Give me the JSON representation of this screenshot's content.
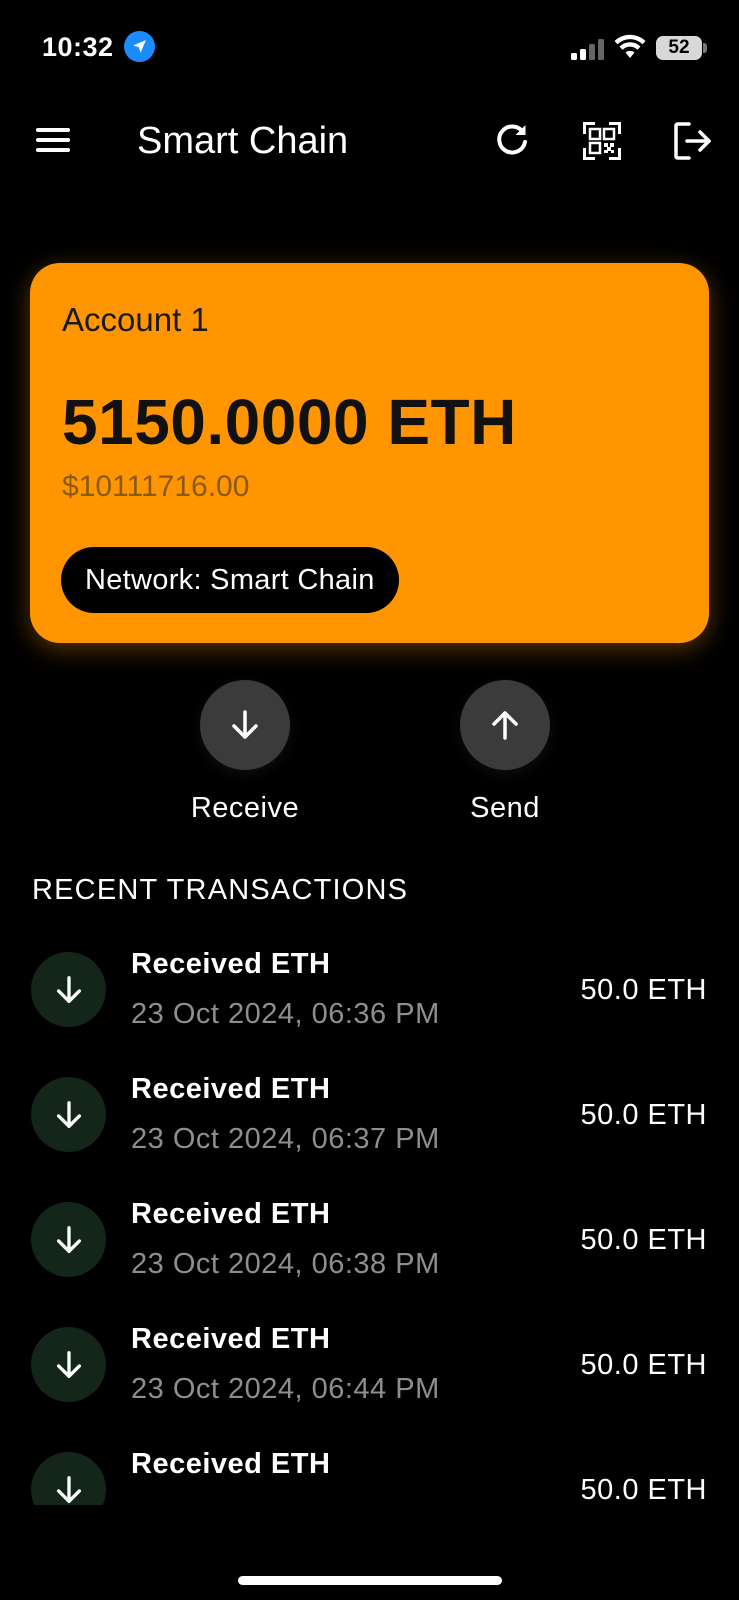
{
  "status_bar": {
    "time": "10:32",
    "battery": "52"
  },
  "app_bar": {
    "title": "Smart Chain"
  },
  "account_card": {
    "account_name": "Account 1",
    "balance": "5150.0000 ETH",
    "fiat_value": "$10111716.00",
    "network": "Network: Smart Chain",
    "card_color": "#ff9500"
  },
  "actions": {
    "receive": "Receive",
    "send": "Send"
  },
  "transactions": {
    "section_title": "RECENT TRANSACTIONS",
    "items": [
      {
        "title": "Received ETH",
        "date": "23 Oct 2024, 06:36 PM",
        "amount": "50.0 ETH"
      },
      {
        "title": "Received ETH",
        "date": "23 Oct 2024, 06:37 PM",
        "amount": "50.0 ETH"
      },
      {
        "title": "Received ETH",
        "date": "23 Oct 2024, 06:38 PM",
        "amount": "50.0 ETH"
      },
      {
        "title": "Received ETH",
        "date": "23 Oct 2024, 06:44 PM",
        "amount": "50.0 ETH"
      },
      {
        "title": "Received ETH",
        "date": "",
        "amount": "50.0 ETH"
      }
    ]
  },
  "icons": [
    "location-arrow-icon",
    "signal-icon",
    "wifi-icon",
    "battery-icon",
    "menu-icon",
    "refresh-icon",
    "qr-code-icon",
    "logout-icon",
    "arrow-down-icon",
    "arrow-up-icon"
  ]
}
